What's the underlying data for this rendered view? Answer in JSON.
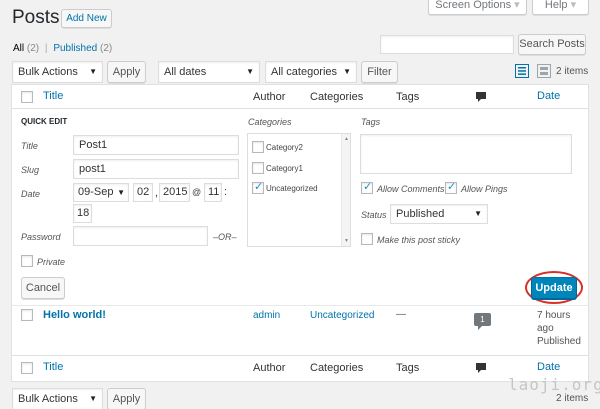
{
  "page": {
    "title": "Posts",
    "add_new": "Add New",
    "screen_options": "Screen Options",
    "help": "Help",
    "caret": "▾"
  },
  "filters": {
    "all_label": "All",
    "all_count": "(2)",
    "separator": "|",
    "published_label": "Published",
    "published_count": "(2)",
    "search_button": "Search Posts",
    "bulk_actions": "Bulk Actions",
    "apply": "Apply",
    "all_dates": "All dates",
    "all_categories": "All categories",
    "filter": "Filter",
    "items_count": "2 items"
  },
  "table": {
    "columns": {
      "title": "Title",
      "author": "Author",
      "categories": "Categories",
      "tags": "Tags",
      "date": "Date"
    }
  },
  "quick_edit": {
    "heading": "QUICK EDIT",
    "title_label": "Title",
    "title_value": "Post1",
    "slug_label": "Slug",
    "slug_value": "post1",
    "date_label": "Date",
    "date_month": "09-Sep",
    "date_day": "02",
    "date_comma": ",",
    "date_year": "2015",
    "date_at": "@",
    "date_hour": "11",
    "date_colon": ":",
    "date_minute": "18",
    "password_label": "Password",
    "or_label": "–OR–",
    "private_label": "Private",
    "categories_label": "Categories",
    "categories": [
      {
        "name": "Category2",
        "checked": false
      },
      {
        "name": "Category1",
        "checked": false
      },
      {
        "name": "Uncategorized",
        "checked": true
      }
    ],
    "tags_label": "Tags",
    "allow_comments": "Allow Comments",
    "allow_pings": "Allow Pings",
    "status_label": "Status",
    "status_value": "Published",
    "sticky_label": "Make this post sticky",
    "cancel": "Cancel",
    "update": "Update"
  },
  "row": {
    "title": "Hello world!",
    "author": "admin",
    "category": "Uncategorized",
    "tags": "—",
    "comments": "1",
    "date_line1": "7 hours",
    "date_line2": "ago",
    "date_line3": "Published"
  },
  "watermark": "laoji.org",
  "colors": {
    "accent": "#0073aa",
    "update_button": "#0085ba",
    "highlight_circle": "#d9302a"
  }
}
